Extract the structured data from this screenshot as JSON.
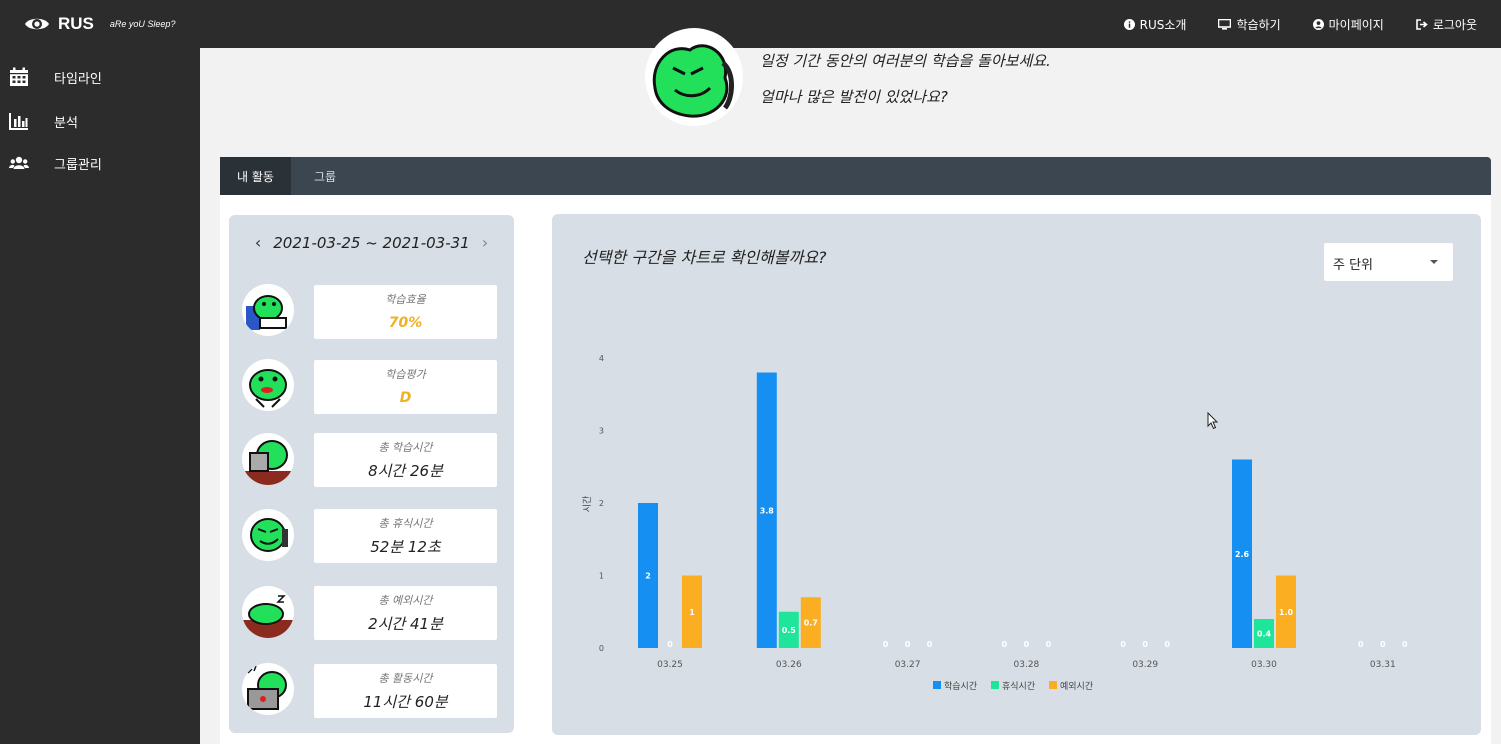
{
  "brand": {
    "name": "RUS",
    "tagline": "aRe yoU Sleep?"
  },
  "nav": [
    {
      "label": "RUS소개",
      "icon": "info-icon"
    },
    {
      "label": "학습하기",
      "icon": "monitor-icon"
    },
    {
      "label": "마이페이지",
      "icon": "user-circle-icon"
    },
    {
      "label": "로그아웃",
      "icon": "logout-icon"
    }
  ],
  "sidebar": {
    "items": [
      {
        "label": "타임라인",
        "icon": "calendar-icon"
      },
      {
        "label": "분석",
        "icon": "bar-chart-icon"
      },
      {
        "label": "그룹관리",
        "icon": "users-icon"
      }
    ]
  },
  "intro": {
    "line1": "일정 기간 동안의 여러분의 학습을 돌아보세요.",
    "line2": "얼마나 많은 발전이 있었나요?"
  },
  "tabs": [
    {
      "label": "내 활동",
      "active": true
    },
    {
      "label": "그룹",
      "active": false
    }
  ],
  "stats": {
    "range": "2021-03-25 ~ 2021-03-31",
    "prev_icon": "chevron-left-icon",
    "next_icon": "chevron-right-icon",
    "cards": [
      {
        "label": "학습효율",
        "value": "70%",
        "highlight": true
      },
      {
        "label": "학습평가",
        "value": "D",
        "highlight": true
      },
      {
        "label": "총 학습시간",
        "value": "8시간 26분",
        "highlight": false
      },
      {
        "label": "총 휴식시간",
        "value": "52분 12초",
        "highlight": false
      },
      {
        "label": "총 예외시간",
        "value": "2시간 41분",
        "highlight": false
      },
      {
        "label": "총 활동시간",
        "value": "11시간 60분",
        "highlight": false
      }
    ]
  },
  "chart_panel": {
    "title": "선택한 구간을 차트로 확인해볼까요?",
    "select_value": "주 단위"
  },
  "colors": {
    "study": "#1590f2",
    "rest": "#1ee59a",
    "exception": "#fbae22",
    "mascot": "#22e05a"
  },
  "chart_data": {
    "type": "bar",
    "title": "",
    "xlabel": "",
    "ylabel": "시간",
    "ylim": [
      0,
      4
    ],
    "yticks": [
      0,
      1,
      2,
      3,
      4
    ],
    "categories": [
      "03.25",
      "03.26",
      "03.27",
      "03.28",
      "03.29",
      "03.30",
      "03.31"
    ],
    "series": [
      {
        "name": "학습시간",
        "values": [
          2.0,
          3.8,
          0,
          0,
          0,
          2.6,
          0
        ],
        "labels": [
          "2",
          "3.8",
          "0",
          "0",
          "0",
          "2.6",
          "0"
        ]
      },
      {
        "name": "휴식시간",
        "values": [
          0,
          0.5,
          0,
          0,
          0,
          0.4,
          0
        ],
        "labels": [
          "0",
          "0.5",
          "0",
          "0",
          "0",
          "0.4",
          "0"
        ]
      },
      {
        "name": "예외시간",
        "values": [
          1.0,
          0.7,
          0,
          0,
          0,
          1.0,
          0
        ],
        "labels": [
          "1",
          "0.7",
          "0",
          "0",
          "0",
          "1.0",
          "0"
        ]
      }
    ],
    "legend": "bottom",
    "grid": false
  }
}
